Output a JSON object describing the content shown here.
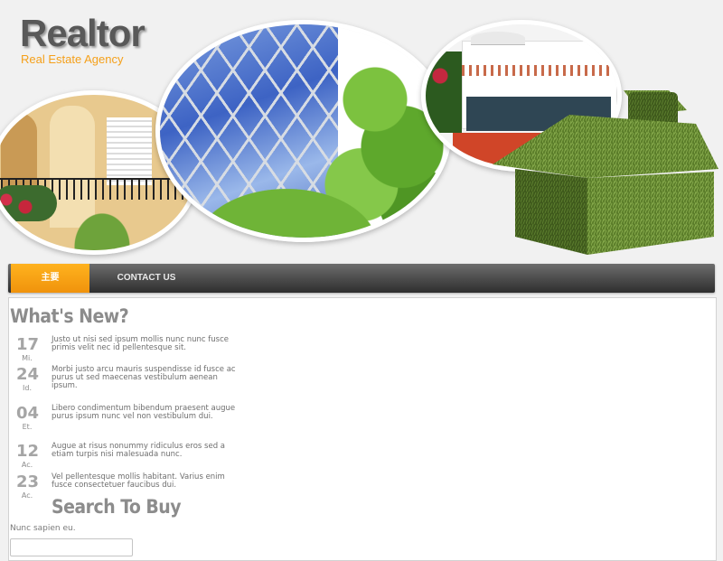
{
  "header": {
    "site_title": "Realtor",
    "site_subtitle": "Real Estate Agency"
  },
  "nav": {
    "items": [
      {
        "label": "主要",
        "active": true
      },
      {
        "label": "CONTACT US",
        "active": false
      }
    ],
    "active_color": "#f5a01a"
  },
  "whats_new": {
    "title": "What's New?",
    "items": [
      {
        "day": "17",
        "month": "Mi.",
        "text": "Justo ut nisi sed ipsum mollis nunc nunc fusce primis velit nec id pellentesque sit."
      },
      {
        "day": "24",
        "month": "Id.",
        "text": "Morbi justo arcu mauris suspendisse id fusce ac purus ut sed maecenas vestibulum aenean ipsum."
      },
      {
        "day": "04",
        "month": "Et.",
        "text": "Libero condimentum bibendum praesent augue purus ipsum nunc vel non vestibulum dui."
      },
      {
        "day": "12",
        "month": "Ac.",
        "text": "Augue at risus nonummy ridiculus eros sed a etiam turpis nisi malesuada nunc."
      },
      {
        "day": "23",
        "month": "Ac.",
        "text": "Vel pellentesque mollis habitant. Varius enim fusce consectetuer faucibus dui."
      }
    ]
  },
  "search": {
    "title": "Search To Buy",
    "description": "Nunc sapien eu.",
    "input_value": ""
  }
}
